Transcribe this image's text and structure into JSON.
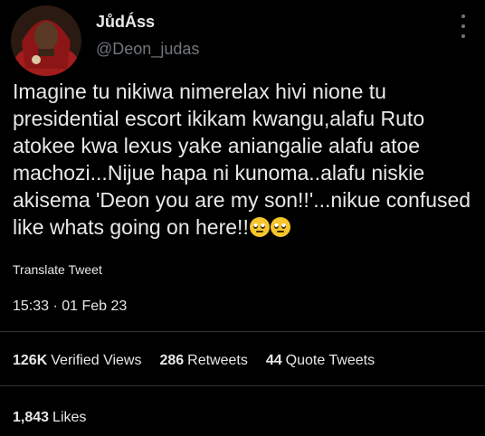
{
  "author": {
    "display_name": "JůdÁss",
    "username": "@Deon_judas"
  },
  "tweet": {
    "text": "Imagine tu nikiwa nimerelax hivi nione tu presidential escort ikikam kwangu,alafu Ruto atokee kwa lexus yake aniangalie alafu atoe machozi...Nijue hapa ni kunoma..alafu niskie akisema 'Deon you are my son!!'...nikue confused like whats going on here!!",
    "emojis": [
      "face-with-rolling-eyes-emoji",
      "face-with-rolling-eyes-emoji"
    ],
    "translate_label": "Translate Tweet",
    "timestamp": "15:33 · 01 Feb 23"
  },
  "stats": {
    "views_count": "126K",
    "views_label": "Verified Views",
    "retweets_count": "286",
    "retweets_label": "Retweets",
    "quotes_count": "44",
    "quotes_label": "Quote Tweets",
    "likes_count": "1,843",
    "likes_label": "Likes"
  },
  "icons": {
    "more": "more-options-icon"
  },
  "colors": {
    "background": "#000000",
    "primary_text": "#e7e9ea",
    "secondary_text": "#71767b",
    "divider": "#2f3336"
  }
}
